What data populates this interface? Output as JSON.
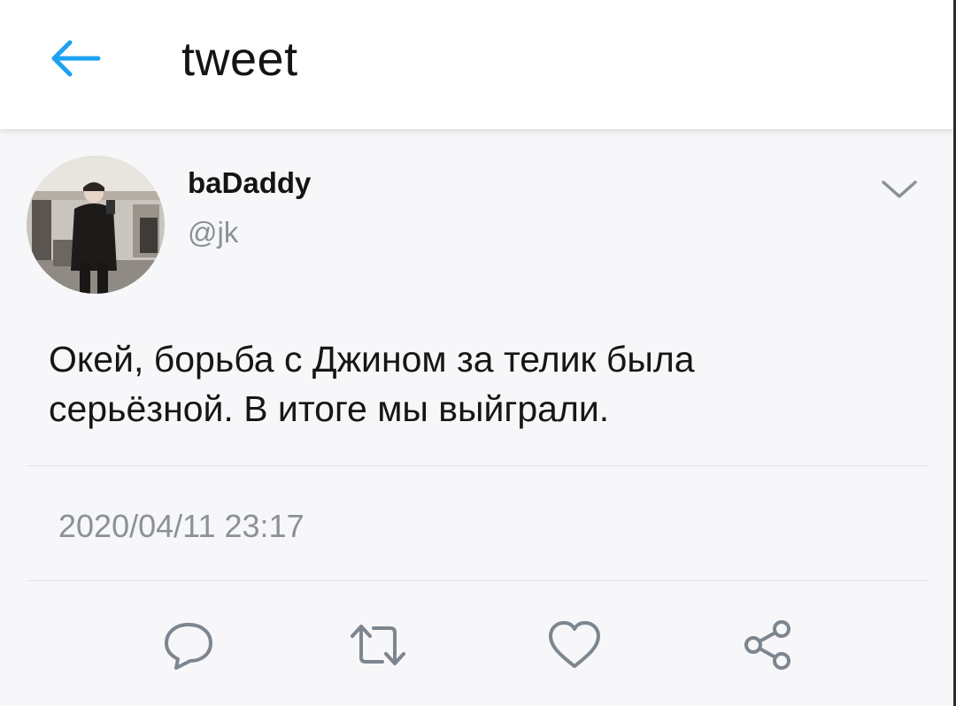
{
  "header": {
    "back_icon": "arrow-left-icon",
    "title": "tweet",
    "accent": "#1da1f2"
  },
  "tweet": {
    "display_name": "baDaddy",
    "handle": "@jk",
    "text": "Окей, борьба с Джином за телик была\nсерьёзной. В итоге мы выйграли.",
    "timestamp": "2020/04/11 23:17",
    "menu_icon": "chevron-down-icon"
  },
  "actions": [
    {
      "name": "reply",
      "icon": "speech-bubble-icon"
    },
    {
      "name": "retweet",
      "icon": "retweet-icon"
    },
    {
      "name": "like",
      "icon": "heart-icon"
    },
    {
      "name": "share",
      "icon": "share-icon"
    }
  ],
  "colors": {
    "background": "#f7f7fa",
    "secondary_text": "#8a9199",
    "icon_gray": "#7d868f"
  }
}
